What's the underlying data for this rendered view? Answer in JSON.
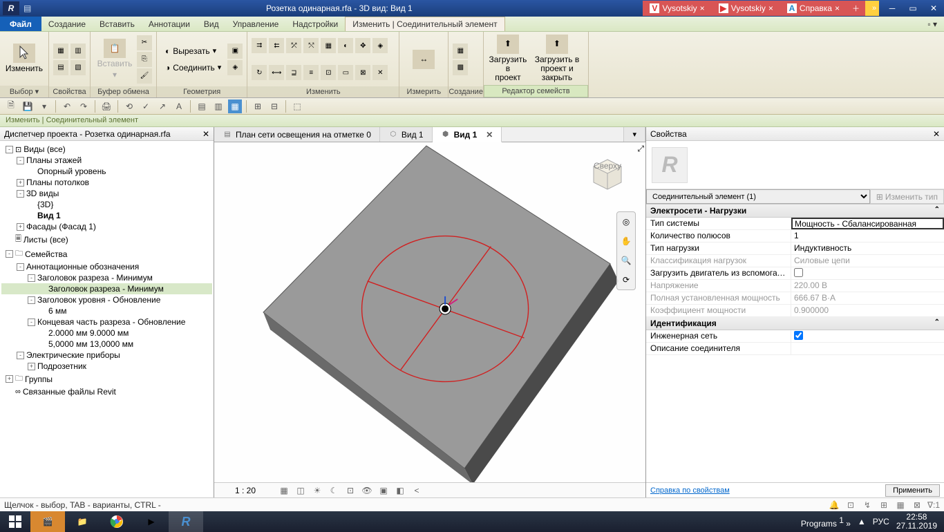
{
  "titlebar": {
    "app_letter": "R",
    "title": "Розетка одинарная.rfa - 3D вид: Вид 1",
    "tabs": [
      {
        "icon": "V",
        "label": "Vysotskiy"
      },
      {
        "icon": "▶",
        "label": "Vysotskiy"
      },
      {
        "icon": "A",
        "label": "Справка"
      }
    ]
  },
  "menu": {
    "file": "Файл",
    "items": [
      "Создание",
      "Вставить",
      "Аннотации",
      "Вид",
      "Управление",
      "Надстройки"
    ],
    "active": "Изменить | Соединительный элемент"
  },
  "ribbon": {
    "panels": {
      "select": {
        "big": "Изменить",
        "title": "Выбор ▾"
      },
      "properties": {
        "big": "Свойства",
        "title": "Свойства"
      },
      "clipboard": {
        "big": "Вставить",
        "title": "Буфер обмена"
      },
      "geometry": {
        "cut": "Вырезать",
        "join": "Соединить",
        "title": "Геометрия"
      },
      "modify": {
        "title": "Изменить"
      },
      "measure": {
        "title": "Измерить"
      },
      "create": {
        "title": "Создание"
      },
      "load1": "Загрузить в\nпроект",
      "load2": "Загрузить в\nпроект и закрыть",
      "editor": "Редактор семейств"
    }
  },
  "contextbar": "Изменить | Соединительный элемент",
  "browser": {
    "title": "Диспетчер проекта - Розетка одинарная.rfa",
    "items": [
      {
        "l": 1,
        "exp": "-",
        "icon": "⊡",
        "text": "Виды (все)"
      },
      {
        "l": 2,
        "exp": "-",
        "text": "Планы этажей"
      },
      {
        "l": 3,
        "exp": "",
        "text": "Опорный уровень"
      },
      {
        "l": 2,
        "exp": "+",
        "text": "Планы потолков"
      },
      {
        "l": 2,
        "exp": "-",
        "text": "3D виды"
      },
      {
        "l": 3,
        "exp": "",
        "text": "{3D}"
      },
      {
        "l": 3,
        "exp": "",
        "text": "Вид 1",
        "bold": true
      },
      {
        "l": 2,
        "exp": "+",
        "text": "Фасады (Фасад 1)"
      },
      {
        "l": 1,
        "exp": "",
        "icon": "🗏",
        "text": "Листы (все)"
      },
      {
        "l": 1,
        "exp": "-",
        "icon": "🗀",
        "text": "Семейства"
      },
      {
        "l": 2,
        "exp": "-",
        "text": "Аннотационные обозначения"
      },
      {
        "l": 3,
        "exp": "-",
        "text": "Заголовок разреза - Минимум"
      },
      {
        "l": 4,
        "exp": "",
        "text": "Заголовок разреза - Минимум",
        "sel": true
      },
      {
        "l": 3,
        "exp": "-",
        "text": "Заголовок уровня - Обновление"
      },
      {
        "l": 4,
        "exp": "",
        "text": "6 мм"
      },
      {
        "l": 3,
        "exp": "-",
        "text": "Концевая часть разреза - Обновление"
      },
      {
        "l": 4,
        "exp": "",
        "text": "2.0000 мм 9.0000  мм"
      },
      {
        "l": 4,
        "exp": "",
        "text": "5,0000 мм 13,0000 мм"
      },
      {
        "l": 2,
        "exp": "-",
        "text": "Электрические приборы"
      },
      {
        "l": 3,
        "exp": "+",
        "text": "Подрозетник"
      },
      {
        "l": 1,
        "exp": "+",
        "icon": "🗀",
        "text": "Группы"
      },
      {
        "l": 1,
        "exp": "",
        "icon": "∞",
        "text": "Связанные файлы Revit"
      }
    ]
  },
  "viewtabs": [
    {
      "icon": "▤",
      "label": "План сети освещения на отметке 0"
    },
    {
      "icon": "⬡",
      "label": "Вид 1"
    },
    {
      "icon": "⬢",
      "label": "Вид 1",
      "active": true
    }
  ],
  "view_controls": {
    "scale": "1 : 20"
  },
  "properties": {
    "title": "Свойства",
    "type_selector": "Соединительный элемент (1)",
    "edit_type": "Изменить тип",
    "sections": [
      {
        "name": "Электросети - Нагрузки",
        "rows": [
          {
            "n": "Тип системы",
            "v": "Мощность - Сбалансированная",
            "boxed": true
          },
          {
            "n": "Количество полюсов",
            "v": "1"
          },
          {
            "n": "Тип нагрузки",
            "v": "Индуктивность"
          },
          {
            "n": "Классификация нагрузок",
            "v": "Силовые цепи",
            "gray": true
          },
          {
            "n": "Загрузить двигатель из вспомогате...",
            "v": "",
            "check": false
          },
          {
            "n": "Напряжение",
            "v": "220.00 В",
            "gray": true
          },
          {
            "n": "Полная установленная мощность",
            "v": "666.67 В·А",
            "gray": true
          },
          {
            "n": "Коэффициент мощности",
            "v": "0.900000",
            "gray": true
          }
        ]
      },
      {
        "name": "Идентификация",
        "rows": [
          {
            "n": "Инженерная сеть",
            "v": "",
            "check": true
          },
          {
            "n": "Описание соединителя",
            "v": ""
          }
        ]
      }
    ],
    "help_link": "Справка по свойствам",
    "apply": "Применить"
  },
  "statusbar": {
    "hint": "Щелчок - выбор, TAB - варианты, CTRL -"
  },
  "taskbar": {
    "programs": "Programs",
    "lang": "РУС",
    "time": "22:58",
    "date": "27.11.2019"
  }
}
